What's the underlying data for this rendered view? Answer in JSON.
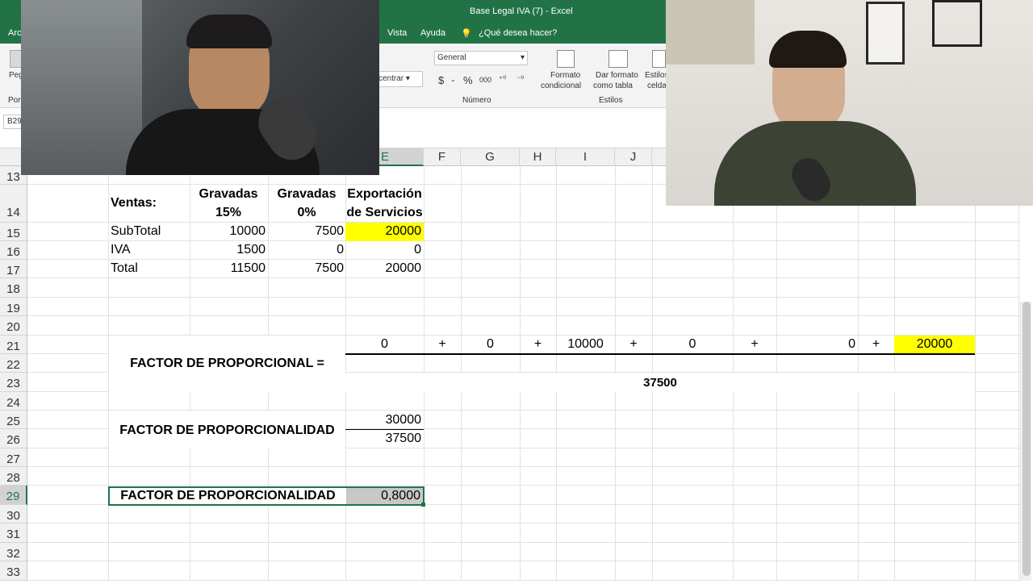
{
  "window": {
    "title": "Base Legal IVA (7)  -  Excel"
  },
  "menu": {
    "view": "Vista",
    "help": "Ayuda",
    "tell_me": "¿Qué desea hacer?",
    "file": "Arc"
  },
  "ribbon": {
    "paste": "Peg",
    "clipboard": "Port",
    "center": "centrar",
    "number_format": "General",
    "currency": "$",
    "percent": "%",
    "thousands": "000",
    "number_group": "Número",
    "cond_format": [
      "Formato",
      "condicional"
    ],
    "table_format": [
      "Dar formato",
      "como tabla"
    ],
    "cell_styles": [
      "Estilos",
      "celda"
    ],
    "styles_group": "Estilos"
  },
  "name_box": "B29",
  "columns": [
    "E",
    "F",
    "G",
    "H",
    "I",
    "J"
  ],
  "rows": [
    "13",
    "14",
    "15",
    "16",
    "17",
    "18",
    "19",
    "20",
    "21",
    "22",
    "23",
    "24",
    "25",
    "26",
    "27",
    "28",
    "29",
    "30",
    "31",
    "32",
    "33"
  ],
  "table": {
    "ventas": "Ventas:",
    "h1": [
      "Gravadas",
      "15%"
    ],
    "h2": [
      "Gravadas",
      "0%"
    ],
    "h3": [
      "Exportación",
      "de Servicios"
    ],
    "subtotal": {
      "label": "SubTotal",
      "g15": "10000",
      "g0": "7500",
      "exp": "20000"
    },
    "iva": {
      "label": "IVA",
      "g15": "1500",
      "g0": "0",
      "exp": "0"
    },
    "total": {
      "label": "Total",
      "g15": "11500",
      "g0": "7500",
      "exp": "20000"
    }
  },
  "factor_eq": "FACTOR DE PROPORCIONAL =",
  "numerator_row": [
    "0",
    "+",
    "0",
    "+",
    "10000",
    "+",
    "0",
    "+",
    "0",
    "+",
    "20000"
  ],
  "denominator": "37500",
  "factor2": {
    "label": "FACTOR DE PROPORCIONALIDAD",
    "num": "30000",
    "den": "37500"
  },
  "result": {
    "label": "FACTOR DE PROPORCIONALIDAD",
    "value": "0,8000"
  },
  "colors": {
    "excel_green": "#217346",
    "highlight": "#ffff00",
    "selected_cell": "#c8c8c8"
  }
}
